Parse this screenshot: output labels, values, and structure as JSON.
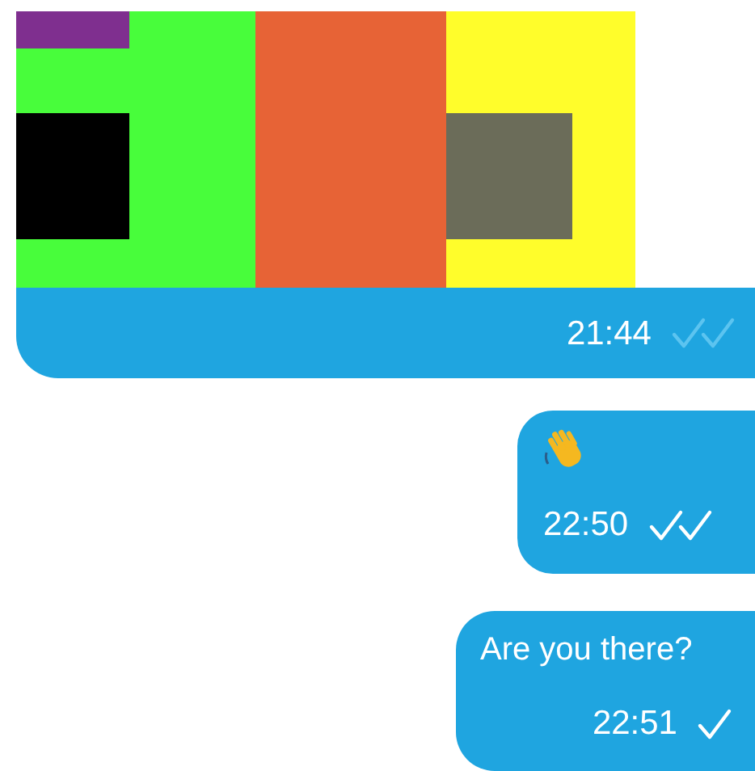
{
  "messages": [
    {
      "time": "21:44",
      "delivered": true,
      "read": false
    },
    {
      "kind": "emoji",
      "time": "22:50",
      "delivered": true,
      "read": true
    },
    {
      "kind": "text",
      "text": "Are you there?",
      "time": "22:51",
      "delivered": false,
      "read": false
    }
  ]
}
